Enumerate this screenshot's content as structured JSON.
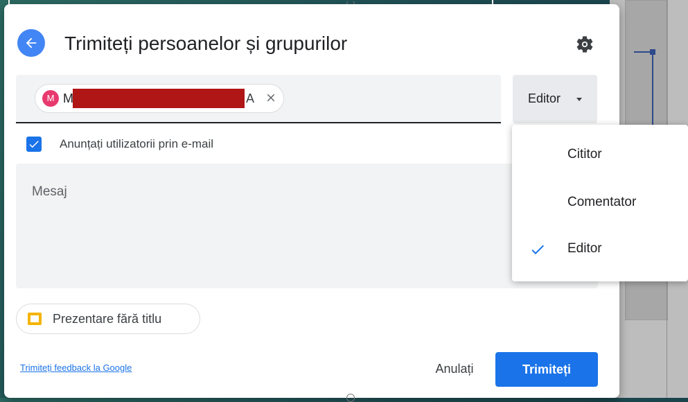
{
  "dialog": {
    "title": "Trimiteți persoanelor și grupurilor"
  },
  "recipient": {
    "avatar_letter": "M",
    "name_start": "M",
    "name_end": "A"
  },
  "role_selector": {
    "current_label": "Editor"
  },
  "role_menu": {
    "items": [
      {
        "label": "Cititor",
        "selected": false
      },
      {
        "label": "Comentator",
        "selected": false
      },
      {
        "label": "Editor",
        "selected": true
      }
    ]
  },
  "notify": {
    "checked": true,
    "label": "Anunțați utilizatorii prin e-mail"
  },
  "message": {
    "placeholder": "Mesaj"
  },
  "file": {
    "name": "Prezentare fără titlu"
  },
  "footer": {
    "feedback_link": "Trimiteți feedback la Google",
    "cancel_label": "Anulați",
    "send_label": "Trimiteți"
  },
  "colors": {
    "accent": "#1a73e8",
    "back_button": "#4285f4",
    "avatar": "#e8396f",
    "slides_icon": "#f4b400"
  },
  "icons": [
    "back-arrow-icon",
    "gear-icon",
    "close-icon",
    "chevron-down-icon",
    "check-icon",
    "slides-file-icon"
  ]
}
